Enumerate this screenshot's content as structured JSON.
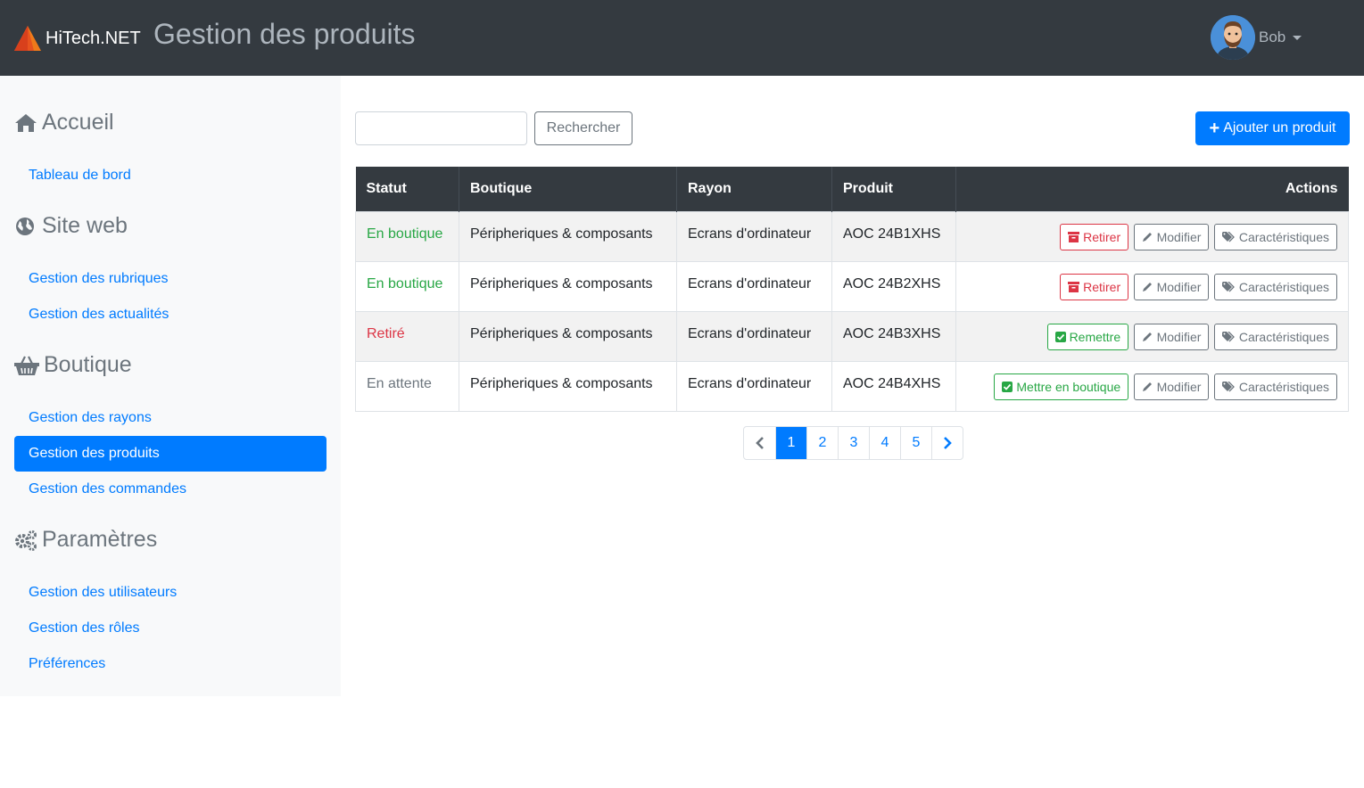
{
  "header": {
    "brand": "HiTech.NET",
    "title": "Gestion des produits",
    "user": "Bob"
  },
  "sidebar": {
    "sections": [
      {
        "title": "Accueil",
        "icon": "home-icon",
        "links": [
          "Tableau de bord"
        ]
      },
      {
        "title": "Site web",
        "icon": "globe-icon",
        "links": [
          "Gestion des rubriques",
          "Gestion des actualités"
        ]
      },
      {
        "title": "Boutique",
        "icon": "basket-icon",
        "links": [
          "Gestion des rayons",
          "Gestion des produits",
          "Gestion des commandes"
        ]
      },
      {
        "title": "Paramètres",
        "icon": "cogs-icon",
        "links": [
          "Gestion des utilisateurs",
          "Gestion des rôles",
          "Préférences"
        ]
      }
    ],
    "active": "Gestion des produits"
  },
  "search": {
    "placeholder": "",
    "button": "Rechercher"
  },
  "add_button": "Ajouter un produit",
  "table": {
    "columns": [
      "Statut",
      "Boutique",
      "Rayon",
      "Produit",
      "Actions"
    ],
    "rows": [
      {
        "status": "En boutique",
        "boutique": "Péripheriques & composants",
        "rayon": "Ecrans d'ordinateur",
        "produit": "AOC 24B1XHS",
        "toggle": "Retirer"
      },
      {
        "status": "En boutique",
        "boutique": "Péripheriques & composants",
        "rayon": "Ecrans d'ordinateur",
        "produit": "AOC 24B2XHS",
        "toggle": "Retirer"
      },
      {
        "status": "Retiré",
        "boutique": "Péripheriques & composants",
        "rayon": "Ecrans d'ordinateur",
        "produit": "AOC 24B3XHS",
        "toggle": "Remettre"
      },
      {
        "status": "En attente",
        "boutique": "Péripheriques & composants",
        "rayon": "Ecrans d'ordinateur",
        "produit": "AOC 24B4XHS",
        "toggle": "Mettre en boutique"
      }
    ],
    "edit_label": "Modifier",
    "specs_label": "Caractéristiques"
  },
  "pagination": {
    "pages": [
      "1",
      "2",
      "3",
      "4",
      "5"
    ],
    "current": "1"
  },
  "colors": {
    "primary": "#007bff",
    "dark": "#343a40",
    "success": "#28a745",
    "danger": "#dc3545",
    "secondary": "#6c757d"
  }
}
